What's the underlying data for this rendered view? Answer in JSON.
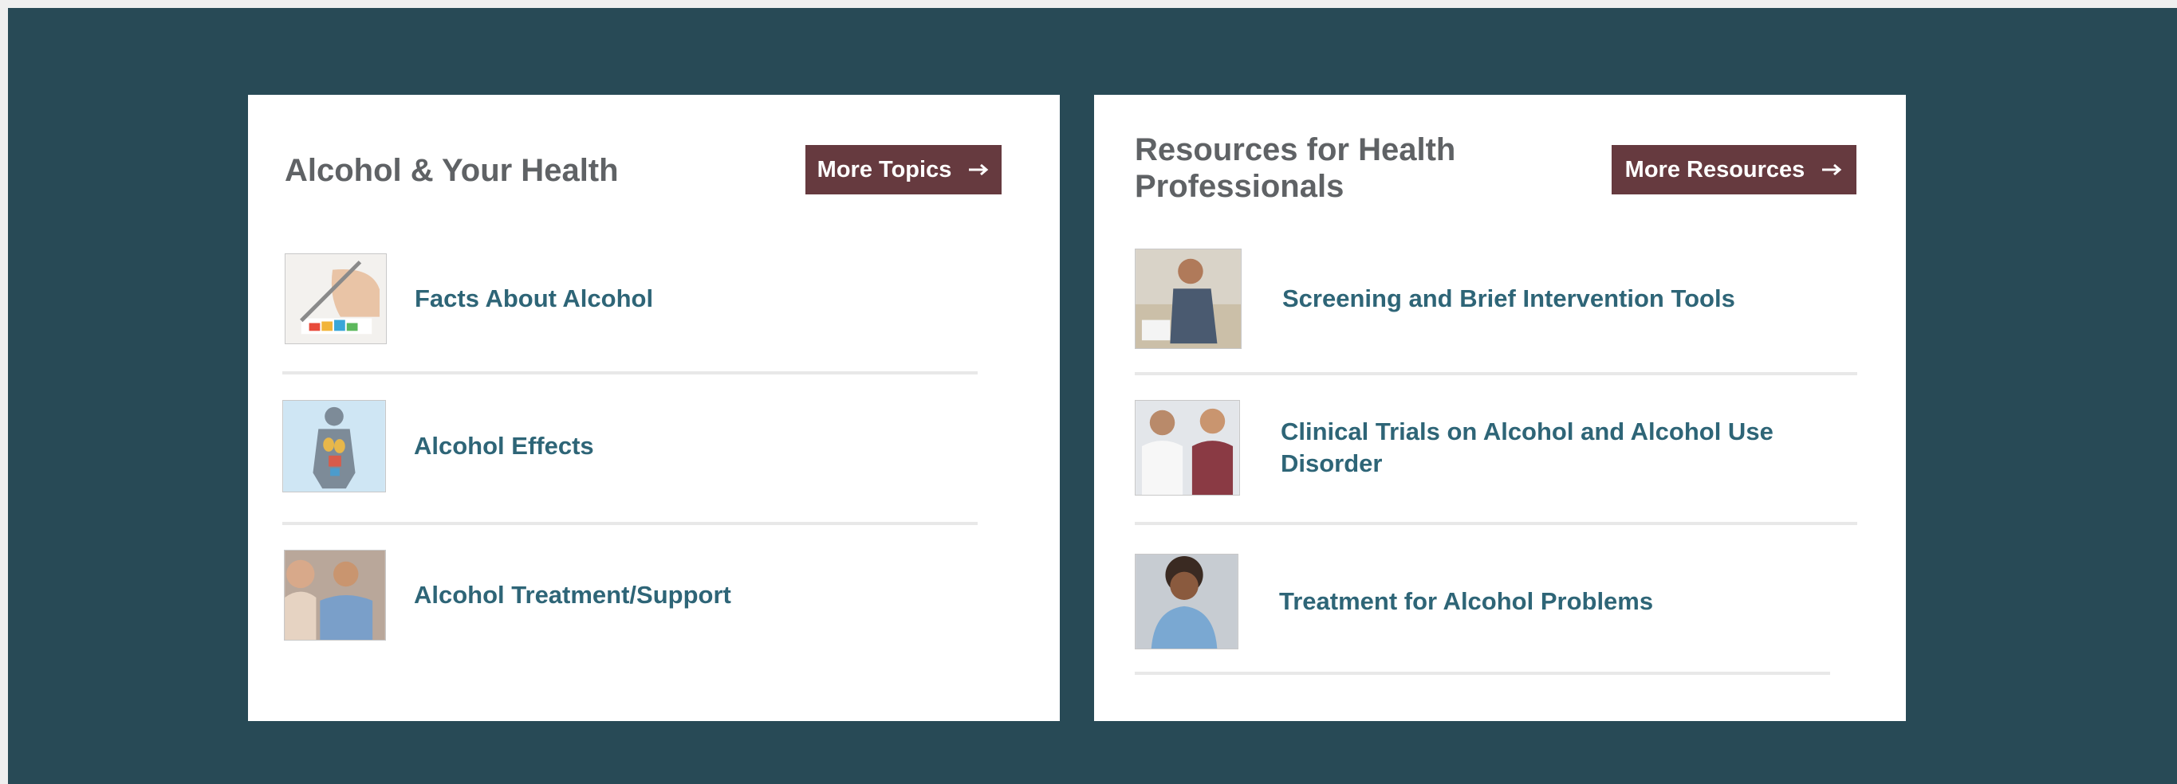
{
  "left_card": {
    "title": "Alcohol & Your Health",
    "button_label": "More Topics",
    "items": [
      {
        "label": "Facts About Alcohol",
        "icon": "pen-chart-icon"
      },
      {
        "label": "Alcohol Effects",
        "icon": "body-organs-icon"
      },
      {
        "label": "Alcohol Treatment/Support",
        "icon": "people-talking-icon"
      }
    ]
  },
  "right_card": {
    "title": "Resources for Health Professionals",
    "button_label": "More Resources",
    "items": [
      {
        "label": "Screening and Brief Intervention Tools",
        "icon": "patient-screening-icon"
      },
      {
        "label": "Clinical Trials on Alcohol and Alcohol Use Disorder",
        "icon": "doctor-patient-icon"
      },
      {
        "label": "Treatment for Alcohol Problems",
        "icon": "woman-portrait-icon"
      }
    ]
  },
  "colors": {
    "background": "#284a56",
    "card": "#ffffff",
    "button": "#663a3f",
    "link": "#2e6577",
    "title": "#5f6265"
  }
}
